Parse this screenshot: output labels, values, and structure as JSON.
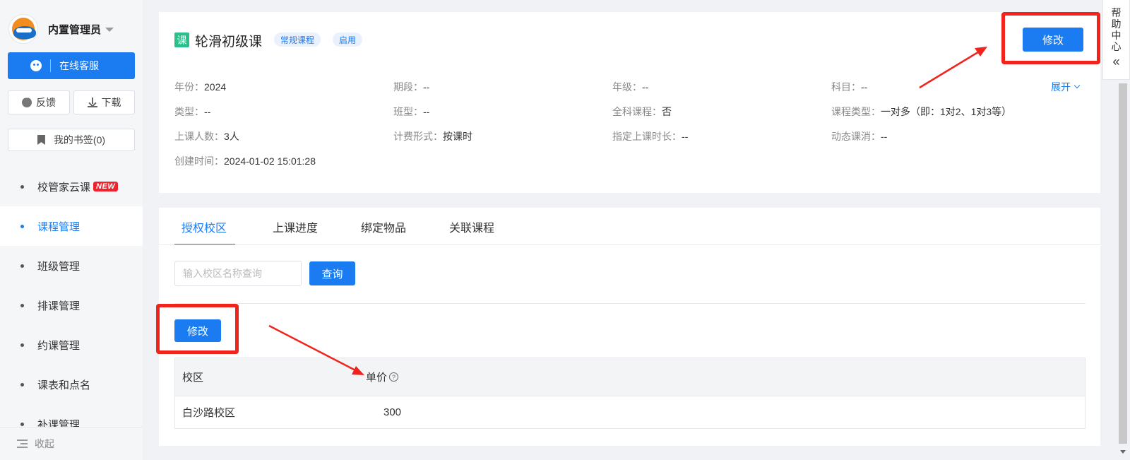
{
  "sidebar": {
    "username": "内置管理员",
    "service_label": "在线客服",
    "feedback_label": "反馈",
    "download_label": "下载",
    "bookmark_label": "我的书签(0)",
    "items": [
      {
        "label": "校管家云课",
        "badge": "NEW"
      },
      {
        "label": "课程管理"
      },
      {
        "label": "班级管理"
      },
      {
        "label": "排课管理"
      },
      {
        "label": "约课管理"
      },
      {
        "label": "课表和点名"
      },
      {
        "label": "补课管理"
      }
    ],
    "collapse_label": "收起"
  },
  "course": {
    "badge": "课",
    "title": "轮滑初级课",
    "tags": [
      "常规课程",
      "启用"
    ],
    "edit_label": "修改",
    "expand_label": "展开",
    "info": [
      [
        {
          "k": "年份：",
          "v": "2024"
        },
        {
          "k": "期段：",
          "v": "--"
        },
        {
          "k": "年级：",
          "v": "--"
        },
        {
          "k": "科目：",
          "v": "--"
        }
      ],
      [
        {
          "k": "类型：",
          "v": "--"
        },
        {
          "k": "班型：",
          "v": "--"
        },
        {
          "k": "全科课程：",
          "v": "否"
        },
        {
          "k": "课程类型：",
          "v": "一对多（即：1对2、1对3等）"
        }
      ],
      [
        {
          "k": "上课人数：",
          "v": "3人"
        },
        {
          "k": "计费形式：",
          "v": "按课时"
        },
        {
          "k": "指定上课时长：",
          "v": "--"
        },
        {
          "k": "动态课消：",
          "v": "--"
        }
      ],
      [
        {
          "k": "创建时间：",
          "v": "2024-01-02 15:01:28"
        }
      ]
    ]
  },
  "tabs": [
    "授权校区",
    "上课进度",
    "绑定物品",
    "关联课程"
  ],
  "search": {
    "placeholder": "输入校区名称查询",
    "button_label": "查询"
  },
  "edit2_label": "修改",
  "table": {
    "headers": [
      "校区",
      "单价"
    ],
    "rows": [
      [
        "白沙路校区",
        "300"
      ]
    ]
  },
  "help": {
    "label": "帮助中心",
    "chevron": "«"
  },
  "colors": {
    "accent": "#1b7cf2",
    "highlight_red": "#f0231d",
    "course_badge": "#2bc08a"
  }
}
